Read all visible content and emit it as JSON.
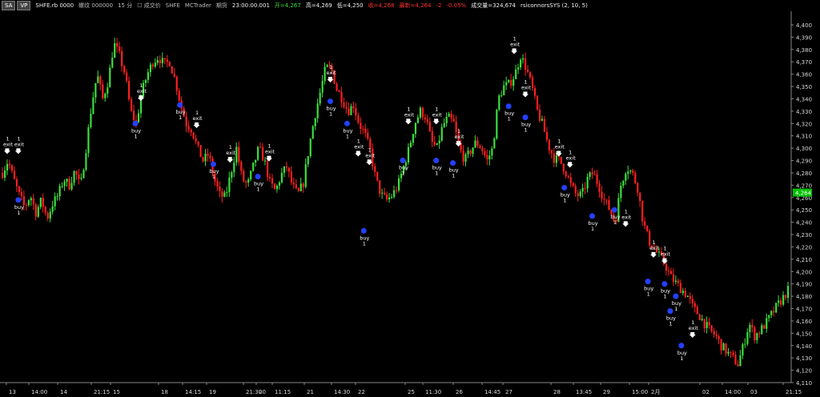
{
  "toolbar": {
    "badge1": "SA",
    "badge2": "VP",
    "symbol": "SHFE.rb 0000",
    "name": "螺纹 000000",
    "interval": "15 分",
    "check": "成交价",
    "exchange": "SHFE",
    "broker": "MCTrader",
    "period_label": "期货",
    "time": "23:00:00.001",
    "open": "开=4,267",
    "high": "高=4,269",
    "low": "低=4,250",
    "close": "收=4,268",
    "last": "最新=4,264",
    "change": "-2",
    "change_pct": "-0.05%",
    "volume": "成交量=324,674",
    "strategy": "rsiconnorsSYS (2, 10, 5)"
  },
  "colors": {
    "up": "#3ce03c",
    "down": "#ff2020",
    "background": "#000000",
    "axis_text": "#d8d8d8",
    "price_tag": "#00c000",
    "marker": "#2440ff"
  },
  "chart_data": {
    "type": "candlestick",
    "title": "",
    "ylim": [
      4110,
      4410
    ],
    "y_ticks": [
      "4,400",
      "4,390",
      "4,380",
      "4,370",
      "4,360",
      "4,350",
      "4,340",
      "4,330",
      "4,320",
      "4,310",
      "4,300",
      "4,290",
      "4,280",
      "4,270",
      "4,260",
      "4,250",
      "4,240",
      "4,230",
      "4,220",
      "4,210",
      "4,200",
      "4,190",
      "4,180",
      "4,170",
      "4,160",
      "4,150",
      "4,140",
      "4,130",
      "4,120",
      "4,110"
    ],
    "x_ticks": [
      "13",
      "14:00",
      "14",
      "21:15",
      "15",
      "18",
      "14:15",
      "19",
      "21:30",
      "20",
      "11:15",
      "21",
      "14:30",
      "22",
      "25",
      "11:30",
      "26",
      "14:45",
      "27",
      "28",
      "13:45",
      "29",
      "15:00",
      "2月",
      "02",
      "14:00",
      "03",
      "21:15"
    ],
    "last_price_label": "4,264",
    "close_path": [
      4280,
      4290,
      4275,
      4262,
      4252,
      4262,
      4248,
      4258,
      4243,
      4255,
      4262,
      4275,
      4270,
      4282,
      4268,
      4300,
      4335,
      4360,
      4340,
      4355,
      4385,
      4375,
      4360,
      4330,
      4320,
      4345,
      4360,
      4370,
      4374,
      4368,
      4370,
      4355,
      4335,
      4320,
      4315,
      4300,
      4290,
      4295,
      4275,
      4262,
      4260,
      4280,
      4300,
      4275,
      4270,
      4285,
      4300,
      4290,
      4272,
      4265,
      4278,
      4285,
      4270,
      4262,
      4272,
      4300,
      4325,
      4345,
      4365,
      4365,
      4348,
      4340,
      4330,
      4335,
      4320,
      4312,
      4298,
      4275,
      4262,
      4258,
      4262,
      4270,
      4285,
      4300,
      4320,
      4330,
      4325,
      4305,
      4300,
      4318,
      4325,
      4320,
      4300,
      4290,
      4298,
      4305,
      4300,
      4290,
      4300,
      4340,
      4350,
      4352,
      4360,
      4375,
      4365,
      4350,
      4330,
      4318,
      4302,
      4292,
      4290,
      4282,
      4270,
      4262,
      4262,
      4275,
      4280,
      4270,
      4258,
      4250,
      4240,
      4270,
      4285,
      4280,
      4268,
      4240,
      4225,
      4218,
      4212,
      4205,
      4195,
      4190,
      4185,
      4180,
      4170,
      4165,
      4158,
      4152,
      4148,
      4140,
      4135,
      4130,
      4125,
      4140,
      4158,
      4148,
      4152,
      4158,
      4165,
      4172,
      4178,
      4185
    ],
    "signals": [
      {
        "type": "exit",
        "label": "exit",
        "qty": "1",
        "x_index": 1,
        "price": 4294
      },
      {
        "type": "exit",
        "label": "exit",
        "qty": "1",
        "x_index": 3,
        "price": 4294
      },
      {
        "type": "buy",
        "label": "buy",
        "qty": "1",
        "x_index": 3,
        "price": 4258
      },
      {
        "type": "exit",
        "label": "exit",
        "qty": "1",
        "x_index": 25,
        "price": 4337
      },
      {
        "type": "buy",
        "label": "buy",
        "qty": "1",
        "x_index": 24,
        "price": 4320
      },
      {
        "type": "buy",
        "label": "buy",
        "qty": "1",
        "x_index": 32,
        "price": 4335
      },
      {
        "type": "exit",
        "label": "exit",
        "qty": "1",
        "x_index": 35,
        "price": 4315
      },
      {
        "type": "buy",
        "label": "buy",
        "qty": "1",
        "x_index": 38,
        "price": 4287
      },
      {
        "type": "exit",
        "label": "exit",
        "qty": "1",
        "x_index": 41,
        "price": 4287
      },
      {
        "type": "buy",
        "label": "buy",
        "qty": "1",
        "x_index": 46,
        "price": 4277
      },
      {
        "type": "exit",
        "label": "exit",
        "qty": "1",
        "x_index": 48,
        "price": 4288
      },
      {
        "type": "exit",
        "label": "exit",
        "qty": "1",
        "x_index": 59,
        "price": 4352
      },
      {
        "type": "buy",
        "label": "buy",
        "qty": "1",
        "x_index": 59,
        "price": 4338
      },
      {
        "type": "buy",
        "label": "buy",
        "qty": "1",
        "x_index": 62,
        "price": 4320
      },
      {
        "type": "exit",
        "label": "exit",
        "qty": "1",
        "x_index": 64,
        "price": 4292
      },
      {
        "type": "exit",
        "label": "exit",
        "qty": "1",
        "x_index": 66,
        "price": 4285
      },
      {
        "type": "buy",
        "label": "buy",
        "qty": "1",
        "x_index": 65,
        "price": 4233
      },
      {
        "type": "exit",
        "label": "exit",
        "qty": "1",
        "x_index": 73,
        "price": 4318
      },
      {
        "type": "buy",
        "label": "buy",
        "qty": "1",
        "x_index": 72,
        "price": 4290
      },
      {
        "type": "exit",
        "label": "exit",
        "qty": "1",
        "x_index": 78,
        "price": 4318
      },
      {
        "type": "buy",
        "label": "buy",
        "qty": "1",
        "x_index": 78,
        "price": 4290
      },
      {
        "type": "exit",
        "label": "exit",
        "qty": "1",
        "x_index": 82,
        "price": 4300
      },
      {
        "type": "buy",
        "label": "buy",
        "qty": "1",
        "x_index": 81,
        "price": 4288
      },
      {
        "type": "exit",
        "label": "exit",
        "qty": "1",
        "x_index": 92,
        "price": 4375
      },
      {
        "type": "buy",
        "label": "buy",
        "qty": "1",
        "x_index": 91,
        "price": 4334
      },
      {
        "type": "exit",
        "label": "exit",
        "qty": "1",
        "x_index": 94,
        "price": 4340
      },
      {
        "type": "buy",
        "label": "buy",
        "qty": "1",
        "x_index": 94,
        "price": 4325
      },
      {
        "type": "exit",
        "label": "exit",
        "qty": "1",
        "x_index": 100,
        "price": 4292
      },
      {
        "type": "buy",
        "label": "buy",
        "qty": "1",
        "x_index": 101,
        "price": 4268
      },
      {
        "type": "exit",
        "label": "exit",
        "qty": "1",
        "x_index": 102,
        "price": 4283
      },
      {
        "type": "buy",
        "label": "buy",
        "qty": "1",
        "x_index": 106,
        "price": 4245
      },
      {
        "type": "buy",
        "label": "buy",
        "qty": "1",
        "x_index": 110,
        "price": 4250
      },
      {
        "type": "exit",
        "label": "exit",
        "qty": "1",
        "x_index": 112,
        "price": 4235
      },
      {
        "type": "exit",
        "label": "exit",
        "qty": "1",
        "x_index": 117,
        "price": 4210
      },
      {
        "type": "exit",
        "label": "exit",
        "qty": "1",
        "x_index": 119,
        "price": 4205
      },
      {
        "type": "buy",
        "label": "buy",
        "qty": "1",
        "x_index": 116,
        "price": 4192
      },
      {
        "type": "buy",
        "label": "buy",
        "qty": "1",
        "x_index": 119,
        "price": 4190
      },
      {
        "type": "buy",
        "label": "buy",
        "qty": "1",
        "x_index": 121,
        "price": 4180
      },
      {
        "type": "buy",
        "label": "buy",
        "qty": "1",
        "x_index": 120,
        "price": 4168
      },
      {
        "type": "exit",
        "label": "exit",
        "qty": "1",
        "x_index": 124,
        "price": 4145
      },
      {
        "type": "buy",
        "label": "buy",
        "qty": "1",
        "x_index": 122,
        "price": 4140
      }
    ]
  }
}
